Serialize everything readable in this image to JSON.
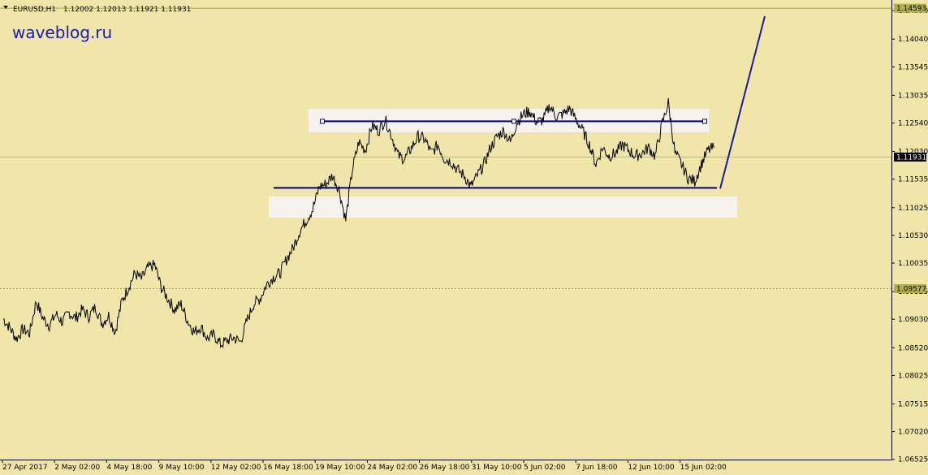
{
  "header": {
    "symbol": "EURUSD,H1",
    "ohlc": "1.12002 1.12013 1.11921 1.11931"
  },
  "watermark": "waveblog.ru",
  "colors": {
    "background": "#f0e6aa",
    "axis": "#000000",
    "price": "#000000",
    "level": "#a8a64a",
    "level_label_bg": "#b2b04c",
    "current_label_bg": "#000000",
    "current_line": "#b4b4b4",
    "channel_line": "#000080",
    "projection_line": "#1a1aa0",
    "zone_fill": "#f7f2ee"
  },
  "chart_data": {
    "type": "line",
    "title": "",
    "symbol": "EURUSD",
    "timeframe": "H1",
    "ylim": [
      1.0652,
      1.1474
    ],
    "x_ticks": [
      "27 Apr 2017",
      "2 May 02:00",
      "4 May 18:00",
      "9 May 10:00",
      "12 May 02:00",
      "16 May 18:00",
      "19 May 10:00",
      "24 May 02:00",
      "26 May 18:00",
      "31 May 10:00",
      "5 Jun 02:00",
      "7 Jun 18:00",
      "12 Jun 10:00",
      "15 Jun 02:00"
    ],
    "y_ticks": [
      "1.14550",
      "1.14040",
      "1.13545",
      "1.13035",
      "1.12540",
      "1.12030",
      "1.11535",
      "1.11025",
      "1.10530",
      "1.10035",
      "1.09525",
      "1.09030",
      "1.08520",
      "1.08025",
      "1.07515",
      "1.07020",
      "1.06525"
    ],
    "y_tick_values": [
      1.1455,
      1.1404,
      1.13545,
      1.13035,
      1.1254,
      1.1203,
      1.11535,
      1.11025,
      1.1053,
      1.10035,
      1.09525,
      1.0903,
      1.0852,
      1.08025,
      1.07515,
      1.0702,
      1.06525
    ],
    "series": [
      {
        "values": [
          1.0904,
          1.0888,
          1.0868,
          1.0885,
          1.0878,
          1.0935,
          1.0905,
          1.0892,
          1.0912,
          1.0898,
          1.0915,
          1.0905,
          1.092,
          1.0908,
          1.0925,
          1.0895,
          1.091,
          1.088,
          1.0935,
          1.096,
          1.0985,
          1.0975,
          1.0995,
          1.1,
          1.096,
          1.094,
          1.092,
          1.093,
          1.09,
          1.088,
          1.089,
          1.0868,
          1.0875,
          1.0858,
          1.0865,
          1.087,
          1.0862,
          1.09,
          1.093,
          1.094,
          1.0965,
          1.0978,
          1.0985,
          1.101,
          1.103,
          1.106,
          1.108,
          1.11,
          1.114,
          1.1145,
          1.116,
          1.1135,
          1.108,
          1.117,
          1.122,
          1.1205,
          1.125,
          1.124,
          1.126,
          1.123,
          1.1195,
          1.119,
          1.121,
          1.123,
          1.1225,
          1.12,
          1.1215,
          1.119,
          1.1185,
          1.117,
          1.116,
          1.114,
          1.116,
          1.118,
          1.121,
          1.123,
          1.124,
          1.122,
          1.1255,
          1.127,
          1.1275,
          1.1255,
          1.126,
          1.1285,
          1.1265,
          1.127,
          1.128,
          1.126,
          1.124,
          1.1215,
          1.118,
          1.121,
          1.1195,
          1.12,
          1.1215,
          1.1205,
          1.1195,
          1.12,
          1.121,
          1.1195,
          1.125,
          1.129,
          1.12,
          1.118,
          1.1155,
          1.115,
          1.118,
          1.1205,
          1.121
        ],
        "x_start": "27 Apr 2017",
        "x_end": "15 Jun 2017"
      }
    ],
    "horizontal_levels": [
      {
        "price": "1.14593",
        "style": "solid"
      },
      {
        "price": "1.09577",
        "style": "dotted"
      }
    ],
    "current_price": "1.11931",
    "channel": {
      "upper": 1.1257,
      "lower": 1.1138
    },
    "projection_target": 1.1445,
    "grid": false
  }
}
